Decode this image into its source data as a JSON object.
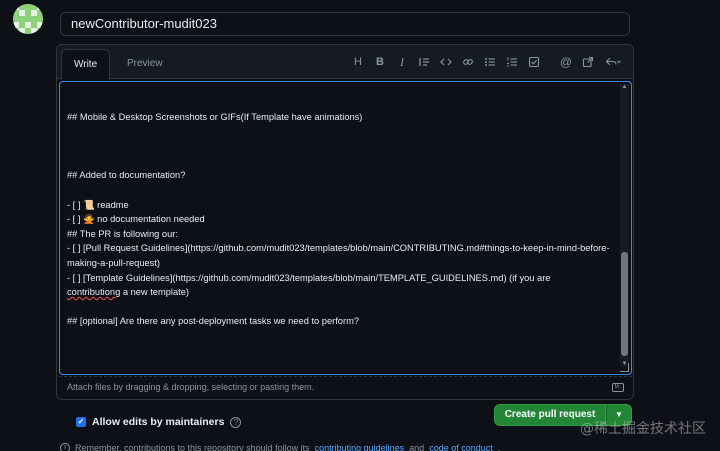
{
  "pr": {
    "title_value": "newContributor-mudit023"
  },
  "editor": {
    "tabs": [
      {
        "label": "Write",
        "active": true
      },
      {
        "label": "Preview",
        "active": false
      }
    ],
    "toolbar": [
      {
        "icon": "heading-icon",
        "label": "H"
      },
      {
        "icon": "bold-icon",
        "label": "B"
      },
      {
        "icon": "italic-icon",
        "label": "I"
      },
      {
        "icon": "quote-icon"
      },
      {
        "icon": "code-icon"
      },
      {
        "icon": "link-icon"
      },
      {
        "icon": "unordered-list-icon"
      },
      {
        "icon": "ordered-list-icon"
      },
      {
        "icon": "task-list-icon"
      },
      {
        "icon": "mention-icon"
      },
      {
        "icon": "cross-reference-icon"
      },
      {
        "icon": "reply-icon"
      }
    ],
    "lines": [
      "## Mobile & Desktop Screenshots or GIFs(If Template have animations)",
      "",
      "",
      "",
      "## Added to documentation?",
      "",
      "- [ ] 📜 readme",
      "- [ ] 🙅 no documentation needed",
      "## The PR is following our:",
      "- [ ] [Pull Request Guidelines](https://github.com/mudit023/templates/blob/main/CONTRIBUTING.md#things-to-keep-in-mind-before-making-a-pull-request)",
      "- [ ] [Template Guidelines](https://github.com/mudit023/templates/blob/main/TEMPLATE_GUIDELINES.md) (if you are",
      "contributiong a new template)",
      "",
      "## [optional] Are there any post-deployment tasks we need to perform?"
    ],
    "misspelled_word": "contributiong",
    "attach_hint": "Attach files by dragging & dropping, selecting or pasting them.",
    "markdown_icon_label": "M↓"
  },
  "footer": {
    "allow_edits_label": "Allow edits by maintainers",
    "allow_edits_checked": true,
    "help_glyph": "?",
    "create_label": "Create pull request",
    "remember_prefix": "Remember, contributions to this repository should follow its",
    "guidelines_link": "contributing guidelines",
    "remember_and": "and",
    "conduct_link": "code of conduct",
    "remember_suffix": "."
  },
  "watermark": "@稀土掘金技术社区",
  "colors": {
    "background": "#0d1117",
    "accent_blue": "#388bfd",
    "button_green": "#238636",
    "link": "#58a6ff"
  }
}
